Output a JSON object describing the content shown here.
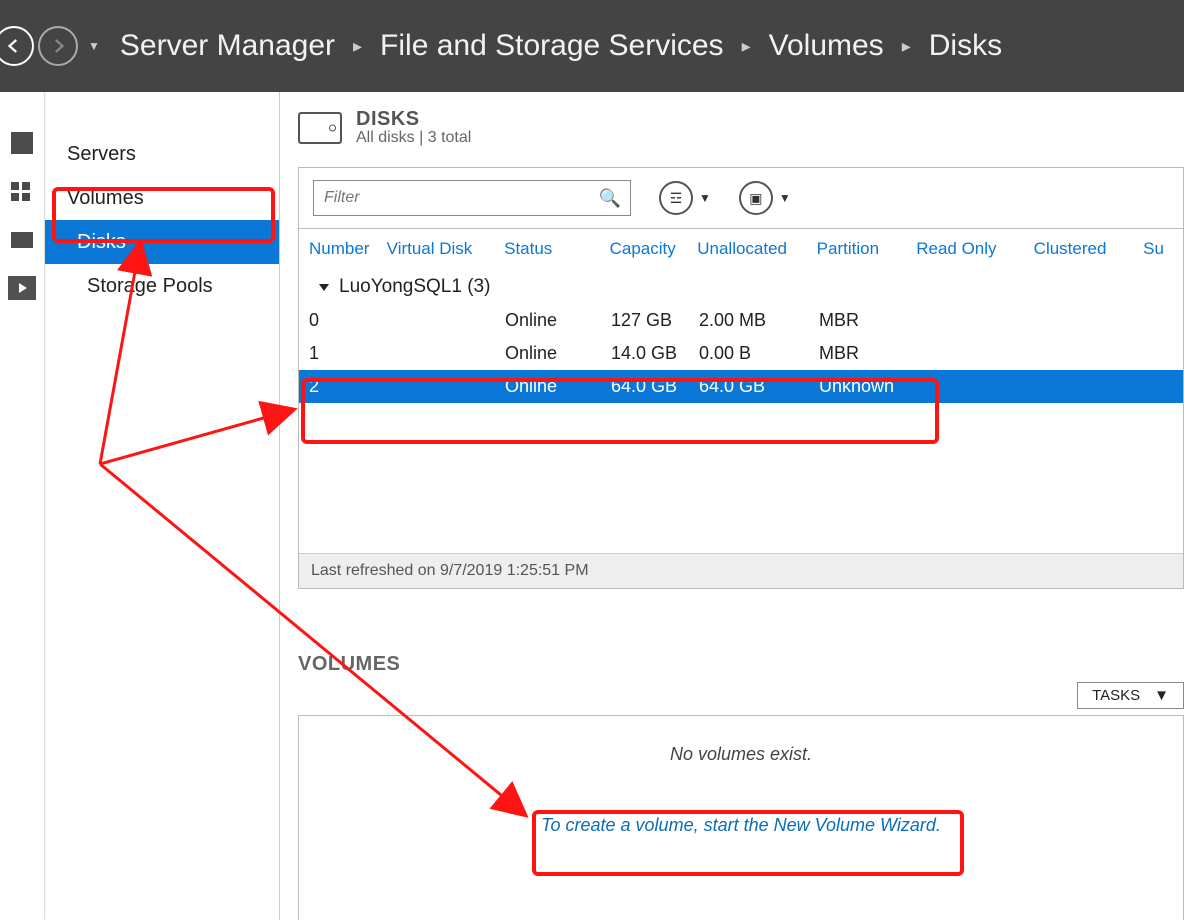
{
  "header": {
    "crumbs": [
      "Server Manager",
      "File and Storage Services",
      "Volumes",
      "Disks"
    ]
  },
  "sidenav": {
    "items": [
      "Servers",
      "Volumes"
    ],
    "selected": "Disks",
    "sub": "Storage Pools"
  },
  "disks_panel": {
    "title": "DISKS",
    "subtitle": "All disks | 3 total",
    "filter_placeholder": "Filter",
    "columns": [
      "Number",
      "Virtual Disk",
      "Status",
      "Capacity",
      "Unallocated",
      "Partition",
      "Read Only",
      "Clustered",
      "Su"
    ],
    "group": "LuoYongSQL1 (3)",
    "rows": [
      {
        "number": "0",
        "vd": "",
        "status": "Online",
        "capacity": "127 GB",
        "unallocated": "2.00 MB",
        "partition": "MBR"
      },
      {
        "number": "1",
        "vd": "",
        "status": "Online",
        "capacity": "14.0 GB",
        "unallocated": "0.00 B",
        "partition": "MBR"
      },
      {
        "number": "2",
        "vd": "",
        "status": "Online",
        "capacity": "64.0 GB",
        "unallocated": "64.0 GB",
        "partition": "Unknown"
      }
    ],
    "footer": "Last refreshed on 9/7/2019 1:25:51 PM"
  },
  "volumes_panel": {
    "title": "VOLUMES",
    "tasks_label": "TASKS",
    "empty_msg": "No volumes exist.",
    "wizard_msg": "To create a volume, start the New Volume Wizard."
  }
}
